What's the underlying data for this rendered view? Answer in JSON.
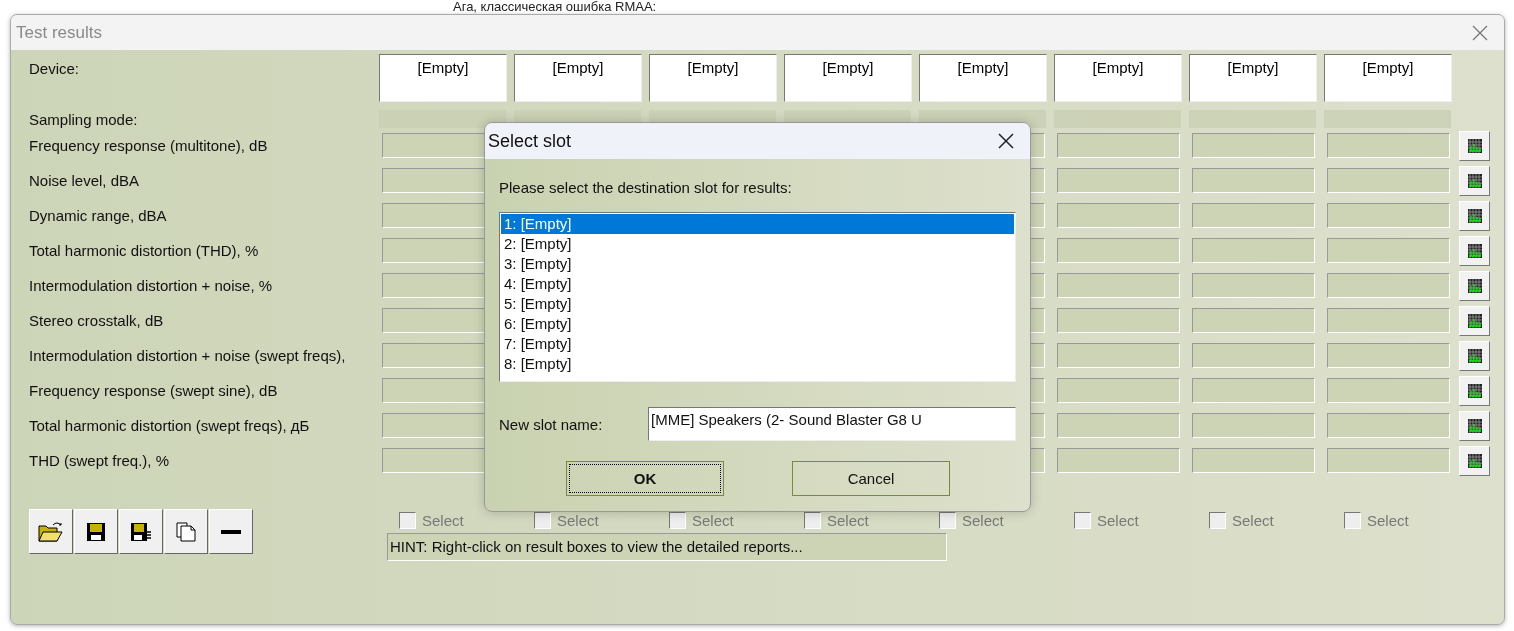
{
  "background_text": "Ага, классическая ошибка RMAA:",
  "window": {
    "title": "Test results"
  },
  "device_label": "Device:",
  "slots": [
    {
      "device": "[Empty]"
    },
    {
      "device": "[Empty]"
    },
    {
      "device": "[Empty]"
    },
    {
      "device": "[Empty]"
    },
    {
      "device": "[Empty]"
    },
    {
      "device": "[Empty]"
    },
    {
      "device": "[Empty]"
    },
    {
      "device": "[Empty]"
    }
  ],
  "sampling_label": "Sampling mode:",
  "tests": [
    {
      "name": "Frequency response (multitone), dB"
    },
    {
      "name": "Noise level, dBA"
    },
    {
      "name": "Dynamic range, dBA"
    },
    {
      "name": "Total harmonic distortion (THD), %"
    },
    {
      "name": "Intermodulation distortion + noise, %"
    },
    {
      "name": "Stereo crosstalk, dB"
    },
    {
      "name": "Intermodulation distortion + noise (swept freqs),"
    },
    {
      "name": "Frequency response (swept sine), dB"
    },
    {
      "name": "Total harmonic distortion (swept freqs), дБ"
    },
    {
      "name": "THD (swept freq.), %"
    }
  ],
  "select_checks": [
    {
      "label": "Select",
      "checked": false
    },
    {
      "label": "Select",
      "checked": false
    },
    {
      "label": "Select",
      "checked": false
    },
    {
      "label": "Select",
      "checked": false
    },
    {
      "label": "Select",
      "checked": false
    },
    {
      "label": "Select",
      "checked": false
    },
    {
      "label": "Select",
      "checked": false
    },
    {
      "label": "Select",
      "checked": false
    }
  ],
  "hint": "HINT: Right-click on result boxes to view the detailed reports...",
  "dialog": {
    "title": "Select slot",
    "prompt": "Please select the destination slot for results:",
    "slots": [
      {
        "label": "1: [Empty]",
        "selected": true
      },
      {
        "label": "2: [Empty]",
        "selected": false
      },
      {
        "label": "3: [Empty]",
        "selected": false
      },
      {
        "label": "4: [Empty]",
        "selected": false
      },
      {
        "label": "5: [Empty]",
        "selected": false
      },
      {
        "label": "6: [Empty]",
        "selected": false
      },
      {
        "label": "7: [Empty]",
        "selected": false
      },
      {
        "label": "8: [Empty]",
        "selected": false
      }
    ],
    "name_label": "New slot name:",
    "name_value": "[MME] Speakers (2- Sound Blaster G8 U",
    "buttons": [
      {
        "label": "OK",
        "default": true
      },
      {
        "label": "Cancel",
        "default": false
      }
    ]
  }
}
